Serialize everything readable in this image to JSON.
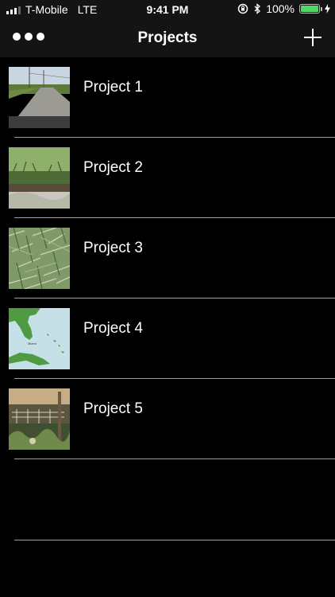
{
  "status_bar": {
    "carrier": "T-Mobile",
    "network": "LTE",
    "time": "9:41 PM",
    "battery_percent": "100%",
    "battery_level": 1.0,
    "battery_color": "#4cd964",
    "icons": [
      "signal-icon",
      "rotation-lock-icon",
      "bluetooth-icon",
      "battery-icon",
      "charging-icon"
    ]
  },
  "nav": {
    "title": "Projects",
    "left_icon": "more-icon",
    "right_icon": "add-icon"
  },
  "projects": [
    {
      "label": "Project 1",
      "thumbnail": "road-photo"
    },
    {
      "label": "Project 2",
      "thumbnail": "grass-edge-photo"
    },
    {
      "label": "Project 3",
      "thumbnail": "grass-closeup-photo"
    },
    {
      "label": "Project 4",
      "thumbnail": "florida-map"
    },
    {
      "label": "Project 5",
      "thumbnail": "fence-photo"
    }
  ]
}
